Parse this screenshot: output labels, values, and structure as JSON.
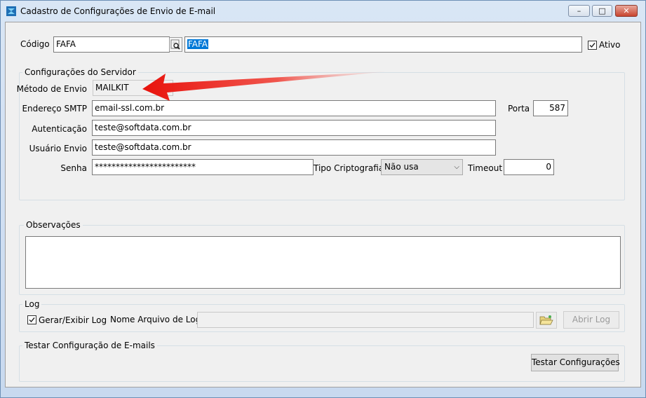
{
  "window": {
    "title": "Cadastro de Configurações de Envio de E-mail",
    "min_glyph": "–",
    "max_glyph": "□",
    "close_glyph": "✕"
  },
  "header": {
    "codigo_label": "Código",
    "codigo_value": "FAFA",
    "descricao_value": "FAFA",
    "ativo_label": "Ativo",
    "ativo_checked": true
  },
  "servidor": {
    "group_title": "Configurações do Servidor",
    "metodo_label": "Método de Envio",
    "metodo_value": "MAILKIT",
    "smtp_label": "Endereço SMTP",
    "smtp_value": "email-ssl.com.br",
    "porta_label": "Porta",
    "porta_value": "587",
    "auth_label": "Autenticação",
    "auth_value": "teste@softdata.com.br",
    "usuario_label": "Usuário Envio",
    "usuario_value": "teste@softdata.com.br",
    "senha_label": "Senha",
    "senha_value": "************************",
    "cripto_label": "Tipo Criptografia",
    "cripto_value": "Não usa",
    "timeout_label": "Timeout",
    "timeout_value": "0"
  },
  "observacoes": {
    "group_title": "Observações",
    "value": ""
  },
  "log": {
    "group_title": "Log",
    "gerar_label": "Gerar/Exibir Log",
    "gerar_checked": true,
    "arquivo_label": "Nome Arquivo de Log",
    "arquivo_value": "",
    "abrir_label": "Abrir Log"
  },
  "teste": {
    "group_title": "Testar Configuração de E-mails",
    "button_label": "Testar Configurações"
  },
  "annotation": {
    "arrow_color": "#e8120c"
  }
}
